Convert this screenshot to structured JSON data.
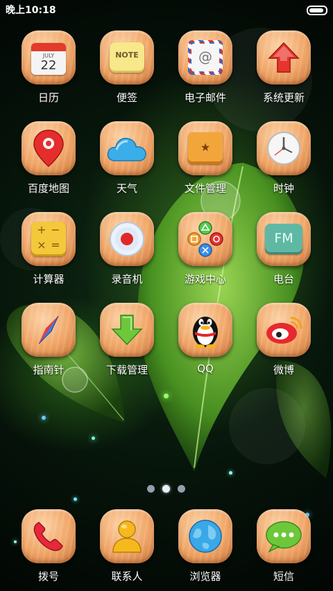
{
  "status": {
    "time": "晚上10:18",
    "battery_level": 0.9
  },
  "apps": [
    {
      "label": "日历",
      "icon": "calendar-icon",
      "calendar_month": "JULY",
      "calendar_day": "22"
    },
    {
      "label": "便签",
      "icon": "note-icon",
      "note_text": "NOTE"
    },
    {
      "label": "电子邮件",
      "icon": "email-icon",
      "email_symbol": "@"
    },
    {
      "label": "系统更新",
      "icon": "update-arrow-icon"
    },
    {
      "label": "百度地图",
      "icon": "map-pin-icon"
    },
    {
      "label": "天气",
      "icon": "cloud-icon"
    },
    {
      "label": "文件管理",
      "icon": "folder-icon"
    },
    {
      "label": "时钟",
      "icon": "clock-icon"
    },
    {
      "label": "计算器",
      "icon": "calculator-icon"
    },
    {
      "label": "录音机",
      "icon": "recorder-icon"
    },
    {
      "label": "游戏中心",
      "icon": "gamepad-icon"
    },
    {
      "label": "电台",
      "icon": "radio-icon",
      "radio_text": "FM"
    },
    {
      "label": "指南针",
      "icon": "compass-icon"
    },
    {
      "label": "下载管理",
      "icon": "download-icon"
    },
    {
      "label": "QQ",
      "icon": "penguin-icon"
    },
    {
      "label": "微博",
      "icon": "weibo-icon"
    }
  ],
  "pager": {
    "count": 3,
    "active_index": 1
  },
  "dock": [
    {
      "label": "拨号",
      "icon": "phone-icon"
    },
    {
      "label": "联系人",
      "icon": "contacts-icon"
    },
    {
      "label": "浏览器",
      "icon": "globe-icon"
    },
    {
      "label": "短信",
      "icon": "message-icon"
    }
  ]
}
